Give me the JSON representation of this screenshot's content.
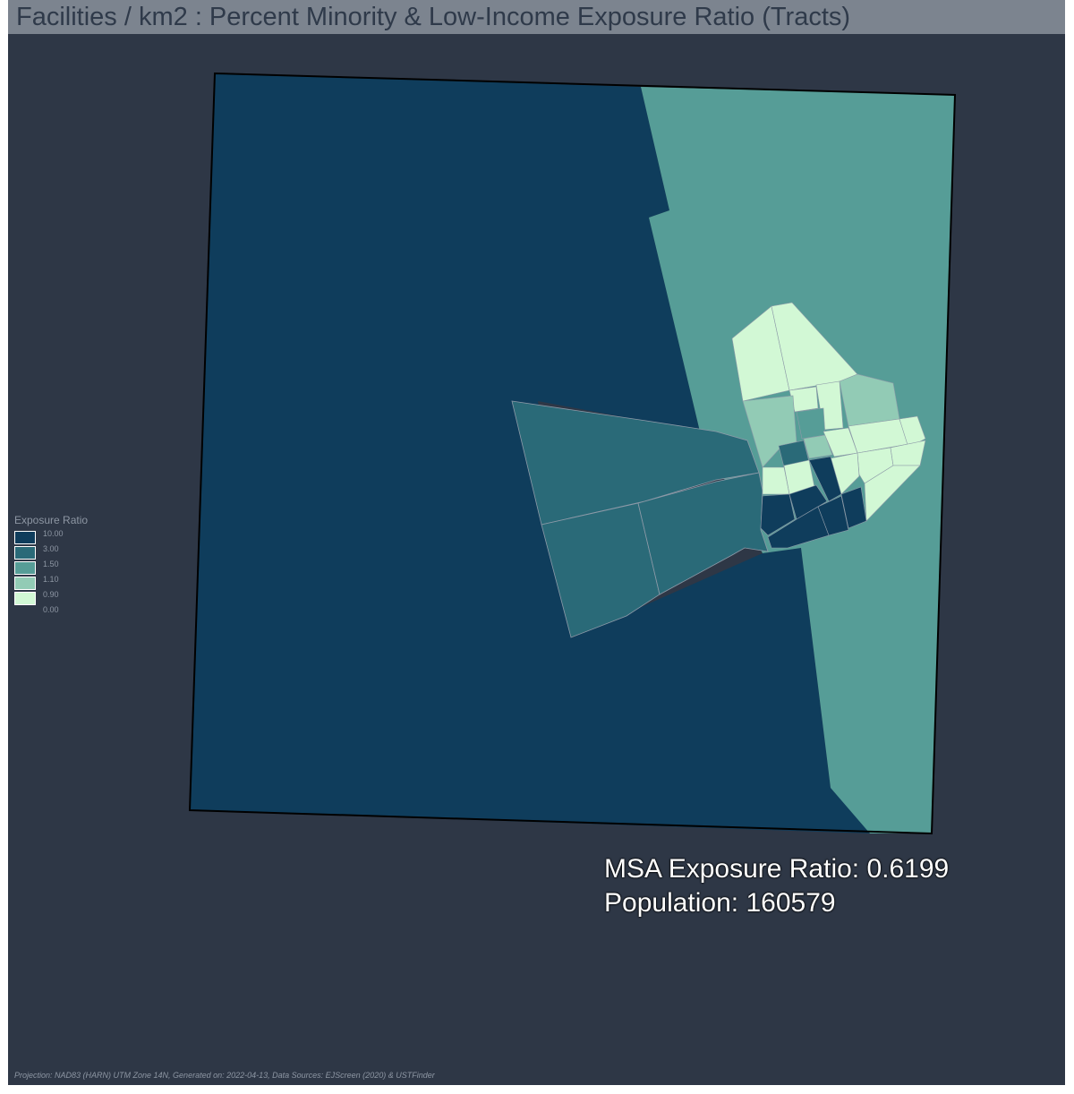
{
  "title": "Facilities / km2 : Percent Minority & Low-Income Exposure Ratio (Tracts)",
  "legend": {
    "title": "Exposure Ratio",
    "items": [
      {
        "label": "10.00",
        "color": "#0f3d5c"
      },
      {
        "label": "3.00",
        "color": "#2a6a78"
      },
      {
        "label": "1.50",
        "color": "#569d97"
      },
      {
        "label": "1.10",
        "color": "#92cbb5"
      },
      {
        "label": "0.90",
        "color": "#d2f8d5"
      },
      {
        "label": "0.00",
        "color": "#d2f8d5"
      }
    ]
  },
  "stats": {
    "exposure_ratio": "MSA Exposure Ratio: 0.6199",
    "population": "Population: 160579"
  },
  "footer": "Projection: NAD83 (HARN) UTM Zone 14N, Generated on: 2022-04-13, Data Sources: EJScreen (2020) & USTFinder",
  "colors": {
    "background": "#2e3746",
    "title_bar": "#7c848f",
    "class_10": "#0f3d5c",
    "class_3": "#2a6a78",
    "class_1_5": "#569d97",
    "class_1_1": "#92cbb5",
    "class_0_9": "#d2f8d5"
  }
}
